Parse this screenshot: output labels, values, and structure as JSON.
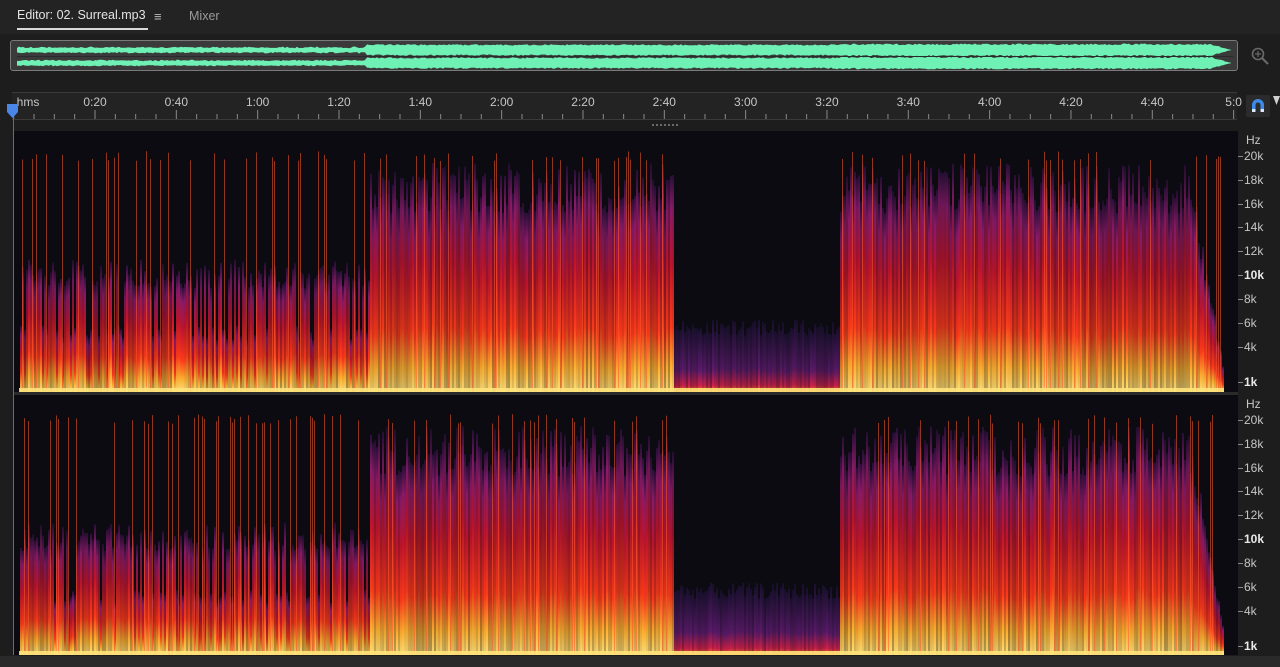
{
  "tabs": [
    {
      "label": "Editor: 02. Surreal.mp3",
      "active": true
    },
    {
      "label": "Mixer",
      "active": false
    }
  ],
  "tab_menu_glyph": "≡",
  "ruler": {
    "unit": "hms",
    "labels": [
      "0:20",
      "0:40",
      "1:00",
      "1:20",
      "1:40",
      "2:00",
      "2:20",
      "2:40",
      "3:00",
      "3:20",
      "3:40",
      "4:00",
      "4:20",
      "4:40",
      "5:0"
    ]
  },
  "hz_axis": {
    "unit": "Hz",
    "labels": [
      "20k",
      "18k",
      "16k",
      "14k",
      "12k",
      "10k",
      "8k",
      "6k",
      "4k",
      "1k"
    ],
    "bold": [
      "10k",
      "1k"
    ]
  },
  "icons": {
    "zoom_navigator": "zoom-navigator-icon",
    "snap": "magnet-snap-icon",
    "playhead": "playhead-marker-icon"
  },
  "colors": {
    "waveform": "#6ff0b4",
    "spectrogram_low": "#0b0b11",
    "spectrogram_mid": "#8a1a6a",
    "spectrogram_hot": "#ff3a1a",
    "spectrogram_peak": "#ffe27a",
    "playhead": "#4a86e8",
    "snap_icon": "#3d8be8"
  }
}
